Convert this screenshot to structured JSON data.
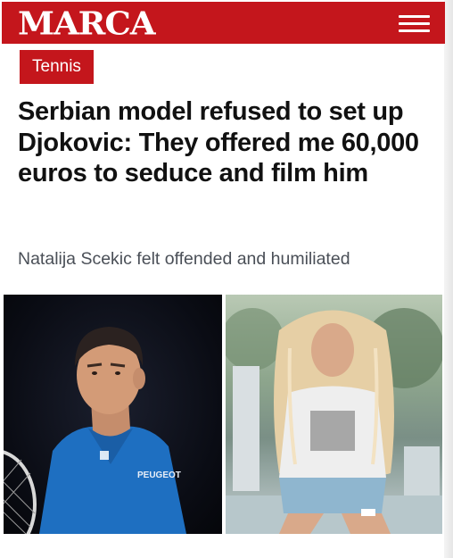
{
  "header": {
    "logo_text": "MARCA",
    "menu_icon": "hamburger-menu-icon",
    "brand_color": "#c4161c"
  },
  "article": {
    "category": "Tennis",
    "headline": "Serbian model refused to set up Djokovic: They offered me 60,000 euros to seduce and film him",
    "subheadline": "Natalija Scekic felt offended and humiliated",
    "images": [
      {
        "subject": "tennis player in blue shirt"
      },
      {
        "subject": "blonde woman sitting outdoors"
      }
    ]
  },
  "colors": {
    "headline_text": "#111111",
    "subheadline_text": "#4a4f57",
    "background": "#ffffff"
  }
}
